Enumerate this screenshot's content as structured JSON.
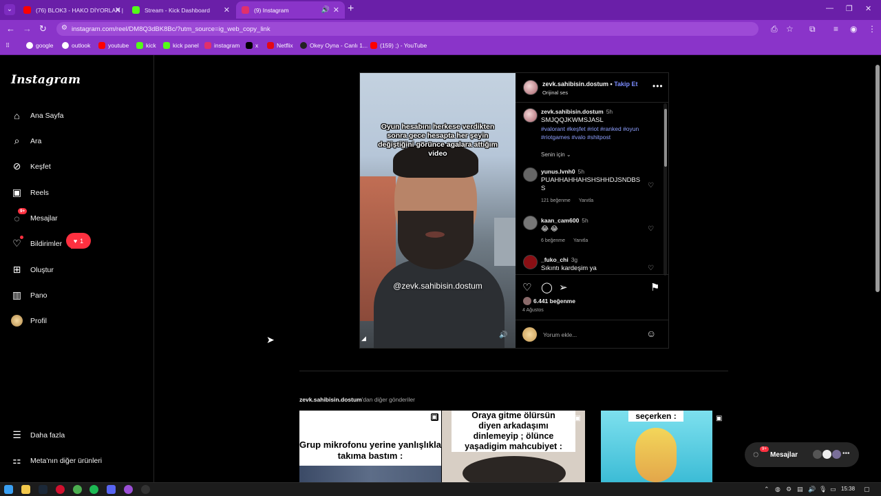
{
  "browser": {
    "tabs": [
      {
        "title": "(76) BLOK3 - HAKO DİYORLAR |",
        "favicon_color": "#ff0000"
      },
      {
        "title": "Stream - Kick Dashboard",
        "favicon_color": "#53fc18"
      },
      {
        "title": "(9) Instagram",
        "favicon_color": "#e1306c"
      }
    ],
    "url": "instagram.com/reel/DM8Q3dBK8Bc/?utm_source=ig_web_copy_link",
    "bookmarks": [
      {
        "label": "google",
        "color": "#ffffff"
      },
      {
        "label": "outlook",
        "color": "#ffffff"
      },
      {
        "label": "youtube",
        "color": "#ff0000"
      },
      {
        "label": "kick",
        "color": "#53fc18"
      },
      {
        "label": "kick panel",
        "color": "#53fc18"
      },
      {
        "label": "instagram",
        "color": "#e1306c"
      },
      {
        "label": "x",
        "color": "#000000"
      },
      {
        "label": "Netflix",
        "color": "#e50914"
      },
      {
        "label": "Okey Oyna - Canlı 1...",
        "color": "#222222"
      },
      {
        "label": "(159) ;) - YouTube",
        "color": "#ff0000"
      }
    ]
  },
  "instagram": {
    "logo": "Instagram",
    "nav": [
      {
        "label": "Ana Sayfa",
        "icon": "home-icon"
      },
      {
        "label": "Ara",
        "icon": "search-icon"
      },
      {
        "label": "Keşfet",
        "icon": "compass-icon"
      },
      {
        "label": "Reels",
        "icon": "reels-icon"
      },
      {
        "label": "Mesajlar",
        "icon": "messenger-icon",
        "badge": "9+"
      },
      {
        "label": "Bildirimler",
        "icon": "heart-icon"
      },
      {
        "label": "Oluştur",
        "icon": "plus-icon"
      },
      {
        "label": "Pano",
        "icon": "dashboard-icon"
      },
      {
        "label": "Profil",
        "icon": "avatar"
      }
    ],
    "notification_pill": "1",
    "bottom_nav": [
      {
        "label": "Daha fazla",
        "icon": "menu-icon"
      },
      {
        "label": "Meta'nın diğer ürünleri",
        "icon": "meta-grid-icon"
      }
    ]
  },
  "post": {
    "video_caption": "Oyun hesabını herkese verdikten sonra gece hesapta her şeyin değiştiğini görünce agalara attığım video",
    "video_watermark": "@zevk.sahibisin.dostum",
    "header": {
      "username": "zevk.sahibisin.dostum",
      "separator": "•",
      "follow": "Takip Et",
      "audio": "Orijinal ses"
    },
    "caption": {
      "username": "zevk.sahibisin.dostum",
      "time": "5h",
      "text": "SMJQQJKWMSJASL",
      "hashtags": "#valorant #keşfet #riot #ranked #oyun #riotgames #valo #shitpost"
    },
    "sort_label": "Senin için",
    "comments": [
      {
        "username": "yunus.lvnh0",
        "time": "5h",
        "text": "PUAHHAHHAHSHSHHDJSNDBSS",
        "likes": "121 beğenme",
        "reply": "Yanıtla"
      },
      {
        "username": "kaan_cam600",
        "time": "5h",
        "text": "😂 😂",
        "likes": "6 beğenme",
        "reply": "Yanıtla"
      },
      {
        "username": "_fuko_chi",
        "time": "3g",
        "text": "Sıkıntı kardeşim ya",
        "likes": "",
        "reply": ""
      }
    ],
    "likes": "6.441 beğenme",
    "date": "4 Ağustos",
    "comment_placeholder": "Yorum ekle..."
  },
  "more_posts": {
    "username": "zevk.sahibisin.dostum",
    "suffix": "'dan diğer gönderiler",
    "thumbs": [
      {
        "text": "Grup mikrofonu yerine yanlışlıkla takıma bastım :"
      },
      {
        "text": "Oraya gitme ölürsün diyen arkadaşımı dinlemeyip ; ölünce yaşadigim mahcubiyet :"
      },
      {
        "text": "seçerken :"
      }
    ]
  },
  "messages_pill": {
    "label": "Mesajlar",
    "badge": "9+"
  },
  "taskbar": {
    "time": "15:38"
  }
}
